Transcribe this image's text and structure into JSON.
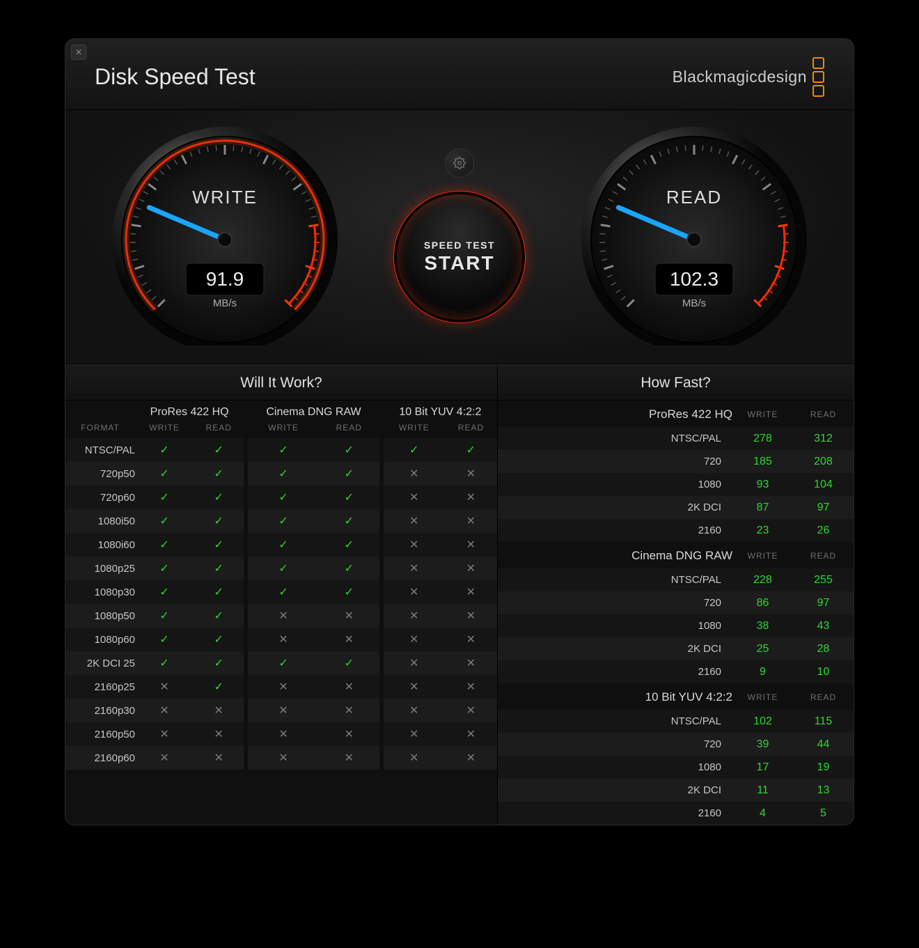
{
  "header": {
    "title": "Disk Speed Test",
    "brand": "Blackmagicdesign"
  },
  "gauges": {
    "write": {
      "label": "WRITE",
      "value": "91.9",
      "unit": "MB/s"
    },
    "read": {
      "label": "READ",
      "value": "102.3",
      "unit": "MB/s"
    }
  },
  "center": {
    "start_line1": "SPEED TEST",
    "start_line2": "START"
  },
  "will_it_work": {
    "title": "Will It Work?",
    "format_header": "FORMAT",
    "sub_write": "WRITE",
    "sub_read": "READ",
    "codecs": [
      "ProRes 422 HQ",
      "Cinema DNG RAW",
      "10 Bit YUV 4:2:2"
    ],
    "rows": [
      {
        "fmt": "NTSC/PAL",
        "cells": [
          1,
          1,
          1,
          1,
          1,
          1
        ]
      },
      {
        "fmt": "720p50",
        "cells": [
          1,
          1,
          1,
          1,
          0,
          0
        ]
      },
      {
        "fmt": "720p60",
        "cells": [
          1,
          1,
          1,
          1,
          0,
          0
        ]
      },
      {
        "fmt": "1080i50",
        "cells": [
          1,
          1,
          1,
          1,
          0,
          0
        ]
      },
      {
        "fmt": "1080i60",
        "cells": [
          1,
          1,
          1,
          1,
          0,
          0
        ]
      },
      {
        "fmt": "1080p25",
        "cells": [
          1,
          1,
          1,
          1,
          0,
          0
        ]
      },
      {
        "fmt": "1080p30",
        "cells": [
          1,
          1,
          1,
          1,
          0,
          0
        ]
      },
      {
        "fmt": "1080p50",
        "cells": [
          1,
          1,
          0,
          0,
          0,
          0
        ]
      },
      {
        "fmt": "1080p60",
        "cells": [
          1,
          1,
          0,
          0,
          0,
          0
        ]
      },
      {
        "fmt": "2K DCI 25",
        "cells": [
          1,
          1,
          1,
          1,
          0,
          0
        ]
      },
      {
        "fmt": "2160p25",
        "cells": [
          0,
          1,
          0,
          0,
          0,
          0
        ]
      },
      {
        "fmt": "2160p30",
        "cells": [
          0,
          0,
          0,
          0,
          0,
          0
        ]
      },
      {
        "fmt": "2160p50",
        "cells": [
          0,
          0,
          0,
          0,
          0,
          0
        ]
      },
      {
        "fmt": "2160p60",
        "cells": [
          0,
          0,
          0,
          0,
          0,
          0
        ]
      }
    ]
  },
  "how_fast": {
    "title": "How Fast?",
    "sub_write": "WRITE",
    "sub_read": "READ",
    "groups": [
      {
        "name": "ProRes 422 HQ",
        "rows": [
          {
            "fmt": "NTSC/PAL",
            "write": 278,
            "read": 312
          },
          {
            "fmt": "720",
            "write": 185,
            "read": 208
          },
          {
            "fmt": "1080",
            "write": 93,
            "read": 104
          },
          {
            "fmt": "2K DCI",
            "write": 87,
            "read": 97
          },
          {
            "fmt": "2160",
            "write": 23,
            "read": 26
          }
        ]
      },
      {
        "name": "Cinema DNG RAW",
        "rows": [
          {
            "fmt": "NTSC/PAL",
            "write": 228,
            "read": 255
          },
          {
            "fmt": "720",
            "write": 86,
            "read": 97
          },
          {
            "fmt": "1080",
            "write": 38,
            "read": 43
          },
          {
            "fmt": "2K DCI",
            "write": 25,
            "read": 28
          },
          {
            "fmt": "2160",
            "write": 9,
            "read": 10
          }
        ]
      },
      {
        "name": "10 Bit YUV 4:2:2",
        "rows": [
          {
            "fmt": "NTSC/PAL",
            "write": 102,
            "read": 115
          },
          {
            "fmt": "720",
            "write": 39,
            "read": 44
          },
          {
            "fmt": "1080",
            "write": 17,
            "read": 19
          },
          {
            "fmt": "2K DCI",
            "write": 11,
            "read": 13
          },
          {
            "fmt": "2160",
            "write": 4,
            "read": 5
          }
        ]
      }
    ]
  }
}
